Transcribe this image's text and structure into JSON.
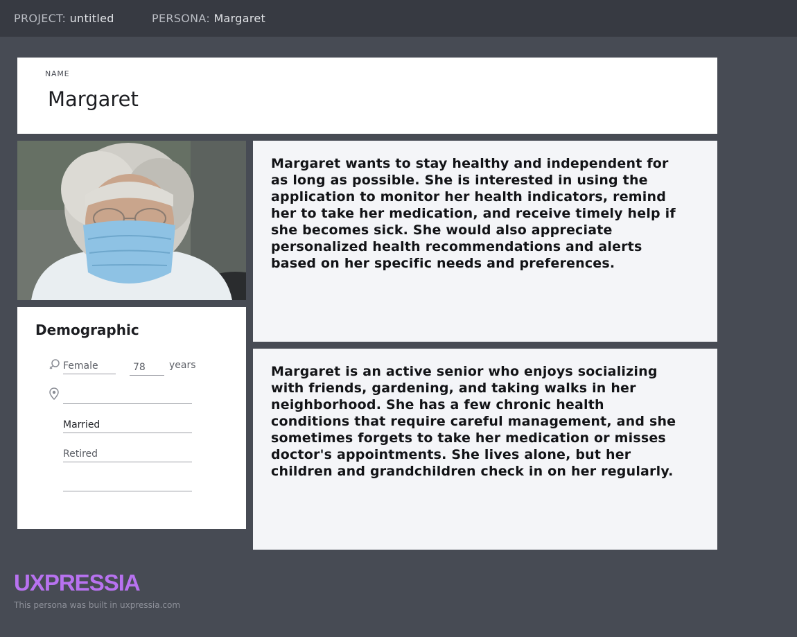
{
  "topbar": {
    "project_key": "PROJECT:",
    "project_value": "untitled",
    "persona_key": "PERSONA:",
    "persona_value": "Margaret"
  },
  "name_card": {
    "label": "NAME",
    "name": "Margaret"
  },
  "photo": {
    "alt": "Portrait of an elderly woman with grey hair, glasses and a blue face mask"
  },
  "demographic": {
    "title": "Demographic",
    "gender": "Female",
    "age": "78",
    "age_unit": "years",
    "location": "",
    "marital_status": "Married",
    "occupation": "Retired",
    "extra": ""
  },
  "goals_text": "Margaret wants to stay healthy and independent for as long as possible. She is interested in using the application to monitor her health indicators, remind her to take her medication, and receive timely help if she becomes sick. She would also appreciate personalized health recommendations and alerts based on her specific needs and preferences.",
  "bio_text": "Margaret is an active senior who enjoys socializing with friends, gardening, and taking walks in her neighborhood. She has a few chronic health conditions that require careful management, and she sometimes forgets to take her medication or misses doctor's appointments. She lives alone, but her children and grandchildren check in on her regularly.",
  "footer": {
    "logo": "UXPRESSIA",
    "note": "This persona was built in uxpressia.com"
  },
  "colors": {
    "background": "#474b54",
    "topbar": "#373a42",
    "brand": "#b872f0",
    "card": "#ffffff",
    "text_card": "#f4f5f8"
  },
  "icons": [
    "gender-icon",
    "location-pin-icon"
  ]
}
